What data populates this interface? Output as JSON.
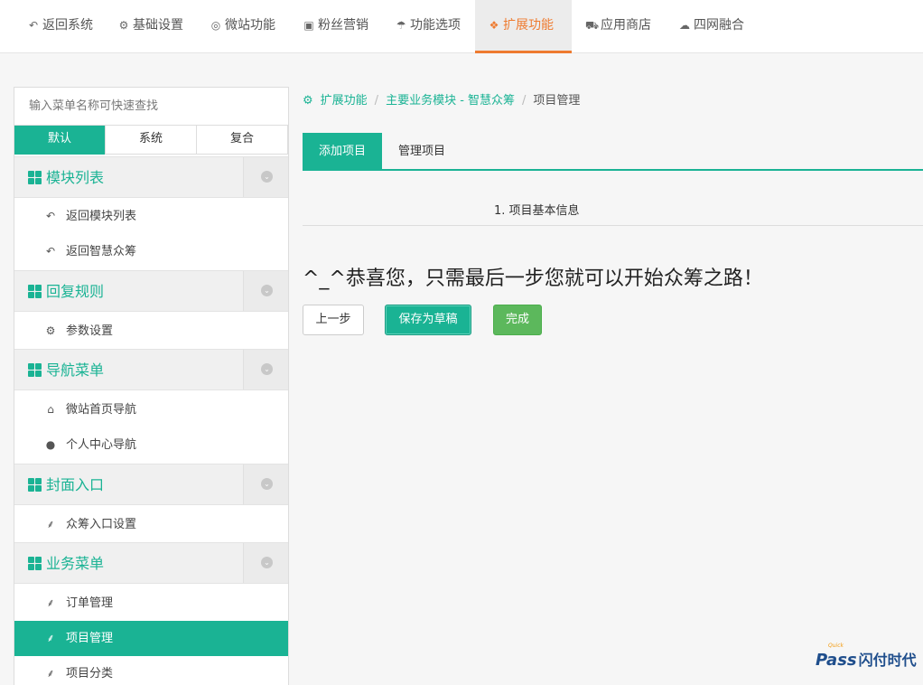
{
  "topnav": {
    "items": [
      {
        "label": "返回系统",
        "icon": "undo-icon"
      },
      {
        "label": "基础设置",
        "icon": "gear-icon"
      },
      {
        "label": "微站功能",
        "icon": "lifebuoy-icon"
      },
      {
        "label": "粉丝营销",
        "icon": "gift-icon"
      },
      {
        "label": "功能选项",
        "icon": "umbrella-icon"
      },
      {
        "label": "扩展功能",
        "icon": "cubes-icon"
      },
      {
        "label": "应用商店",
        "icon": "cart-icon"
      },
      {
        "label": "四网融合",
        "icon": "cloud-icon"
      }
    ],
    "active_index": 5,
    "accent_color": "#ee7b30"
  },
  "sidebar": {
    "search_placeholder": "输入菜单名称可快速查找",
    "filter_tabs": [
      "默认",
      "系统",
      "复合"
    ],
    "active_filter": 0,
    "groups": [
      {
        "label": "模块列表",
        "items": [
          {
            "label": "返回模块列表",
            "icon": "reply-icon"
          },
          {
            "label": "返回智慧众筹",
            "icon": "reply-icon"
          }
        ]
      },
      {
        "label": "回复规则",
        "items": [
          {
            "label": "参数设置",
            "icon": "gear-icon"
          }
        ]
      },
      {
        "label": "导航菜单",
        "items": [
          {
            "label": "微站首页导航",
            "icon": "home-icon"
          },
          {
            "label": "个人中心导航",
            "icon": "user-icon"
          }
        ]
      },
      {
        "label": "封面入口",
        "items": [
          {
            "label": "众筹入口设置",
            "icon": "leaf-icon"
          }
        ]
      },
      {
        "label": "业务菜单",
        "items": [
          {
            "label": "订单管理",
            "icon": "leaf-icon"
          },
          {
            "label": "项目管理",
            "icon": "leaf-icon",
            "active": true
          },
          {
            "label": "项目分类",
            "icon": "leaf-icon"
          }
        ]
      }
    ],
    "accent_color": "#1ab394"
  },
  "breadcrumb": {
    "items": [
      "扩展功能",
      "主要业务模块 - 智慧众筹",
      "项目管理"
    ]
  },
  "main": {
    "tabs": [
      "添加项目",
      "管理项目"
    ],
    "active_tab": 0,
    "step_label": "1. 项目基本信息",
    "congrats_text": "^_^恭喜您，只需最后一步您就可以开始众筹之路！",
    "buttons": {
      "prev": "上一步",
      "draft": "保存为草稿",
      "done": "完成"
    }
  },
  "watermark": {
    "brand": "Pass",
    "quick": "Quick",
    "cn": "闪付时代"
  }
}
